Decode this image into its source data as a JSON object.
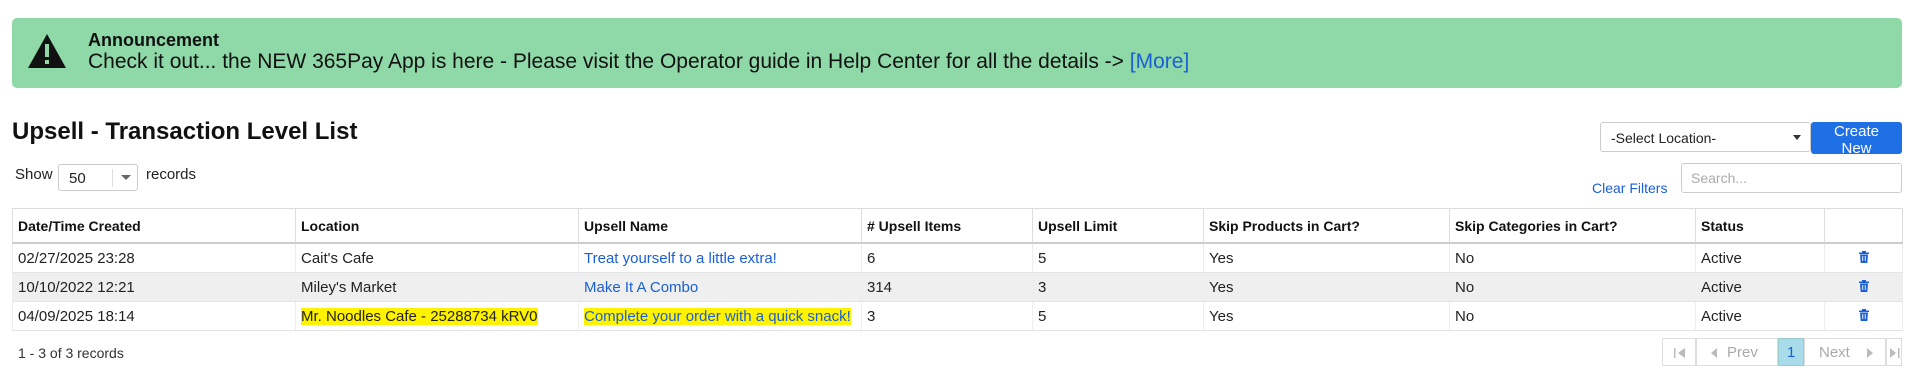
{
  "announcement": {
    "title": "Announcement",
    "message": "Check it out... the NEW 365Pay App is here - Please visit the Operator guide in Help Center for all the details ->",
    "link": "[More]",
    "icon": "warning-triangle-icon",
    "background": "#8fd8a8"
  },
  "page": {
    "title": "Upsell - Transaction Level List"
  },
  "show": {
    "label": "Show",
    "value": "50",
    "suffix": "records"
  },
  "location_select": {
    "value": "-Select Location-"
  },
  "create_button": {
    "label": "Create New",
    "color": "#1f6fe5"
  },
  "clear_filters": "Clear Filters",
  "search": {
    "placeholder": "Search...",
    "value": ""
  },
  "table": {
    "columns": [
      "Date/Time Created",
      "Location",
      "Upsell Name",
      "# Upsell Items",
      "Upsell Limit",
      "Skip Products in Cart?",
      "Skip Categories in Cart?",
      "Status",
      ""
    ],
    "rows": [
      {
        "date": "02/27/2025 23:28",
        "location": "Cait's Cafe",
        "name": "Treat yourself to a little extra!",
        "items": "6",
        "limit": "5",
        "skip_products": "Yes",
        "skip_categories": "No",
        "status": "Active"
      },
      {
        "date": "10/10/2022 12:21",
        "location": "Miley's Market",
        "name": "Make It A Combo",
        "items": "314",
        "limit": "3",
        "skip_products": "Yes",
        "skip_categories": "No",
        "status": "Active"
      },
      {
        "date": "04/09/2025 18:14",
        "location": "Mr. Noodles Cafe - 25288734 kRV0",
        "name": "Complete your order with a quick snack!",
        "items": "3",
        "limit": "5",
        "skip_products": "Yes",
        "skip_categories": "No",
        "status": "Active"
      }
    ],
    "highlight_color": "#fff200"
  },
  "footer": {
    "info": "1 - 3 of 3 records"
  },
  "pagination": {
    "prev": "Prev",
    "current": "1",
    "next": "Next"
  }
}
